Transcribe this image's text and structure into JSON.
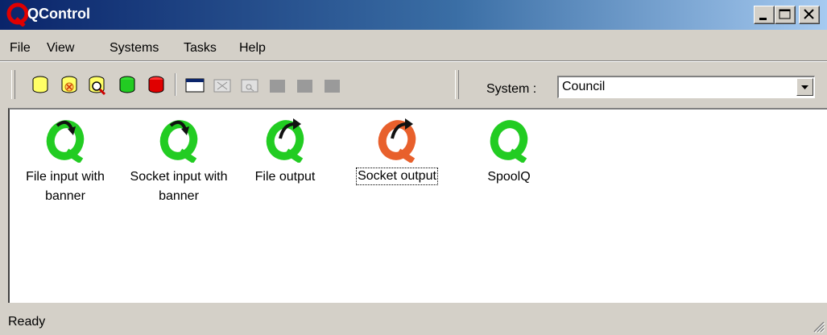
{
  "window": {
    "title": "QControl"
  },
  "menu": [
    "File",
    "View",
    "Systems",
    "Tasks",
    "Help"
  ],
  "toolbar": {
    "system_label": "System :",
    "system_value": "Council",
    "tools": [
      "queue-icon",
      "queue-stop-icon",
      "queue-search-icon",
      "queue-green-icon",
      "queue-red-icon",
      "window-icon",
      "window-close-icon",
      "window-view-icon",
      "gray-block-icon",
      "gray-block-icon",
      "gray-block-icon"
    ]
  },
  "items": [
    {
      "label": "File input with banner",
      "icon": "q-input-icon",
      "color": "#22cc22"
    },
    {
      "label": "Socket input with banner",
      "icon": "q-input-icon",
      "color": "#22cc22"
    },
    {
      "label": "File output",
      "icon": "q-output-icon",
      "color": "#22cc22"
    },
    {
      "label": "Socket output",
      "icon": "q-output-icon",
      "color": "#e8602c"
    },
    {
      "label": "SpoolQ",
      "icon": "q-icon",
      "color": "#22cc22"
    }
  ],
  "status": {
    "text": "Ready"
  },
  "colors": {
    "title_bar": "#0a246a",
    "chrome": "#d4d0c8",
    "content_bg": "#ffffff",
    "q_green": "#22cc22",
    "q_orange": "#e8602c"
  }
}
